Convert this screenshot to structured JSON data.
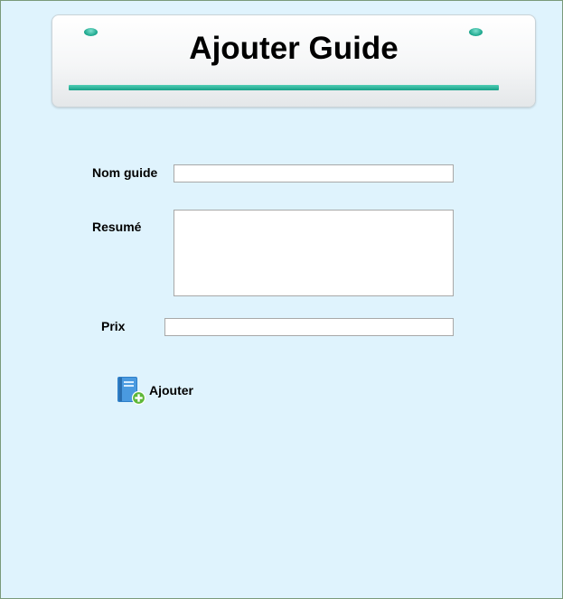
{
  "header": {
    "title": "Ajouter Guide"
  },
  "form": {
    "nom_guide": {
      "label": "Nom guide",
      "value": ""
    },
    "resume": {
      "label": "Resumé",
      "value": ""
    },
    "prix": {
      "label": "Prix",
      "value": ""
    }
  },
  "actions": {
    "add_label": "Ajouter",
    "add_icon": "book-add-icon"
  },
  "colors": {
    "background": "#dff3fd",
    "accent_teal": "#1fa98f",
    "add_icon_green": "#6cc24a",
    "book_blue": "#3d8fd6"
  }
}
